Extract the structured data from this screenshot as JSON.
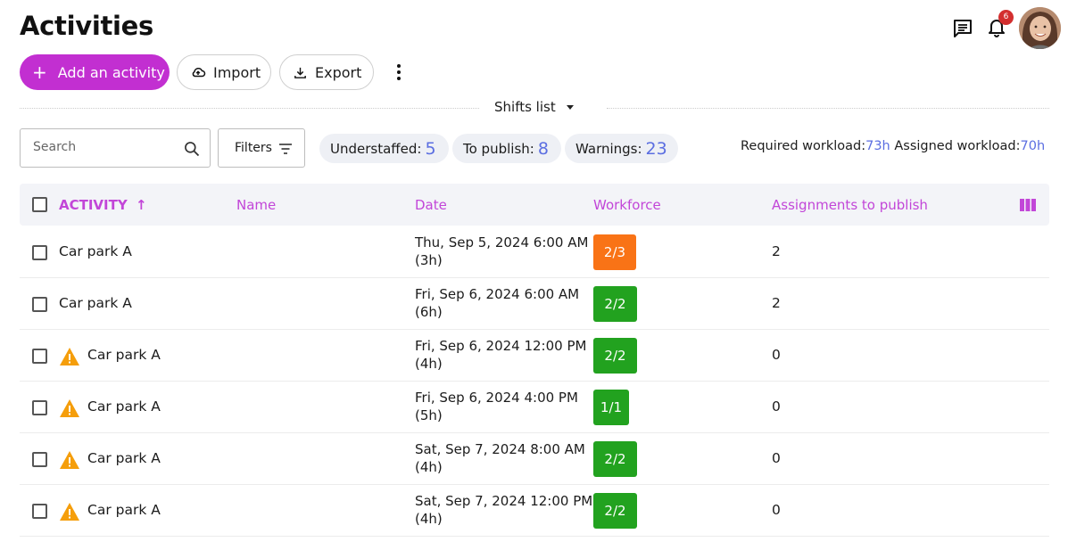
{
  "header": {
    "title": "Activities",
    "notification_count": "6"
  },
  "toolbar": {
    "add_label": "Add an activity",
    "import_label": "Import",
    "export_label": "Export"
  },
  "view": {
    "label": "Shifts list"
  },
  "search": {
    "placeholder": "Search"
  },
  "filters": {
    "label": "Filters"
  },
  "stats": [
    {
      "label": "Understaffed:",
      "value": "5"
    },
    {
      "label": "To publish:",
      "value": "8"
    },
    {
      "label": "Warnings:",
      "value": "23"
    }
  ],
  "workload": {
    "required_label": "Required workload:",
    "required_value": "73h",
    "assigned_label": "Assigned workload:",
    "assigned_value": "70h"
  },
  "table": {
    "columns": [
      "ACTIVITY",
      "Name",
      "Date",
      "Workforce",
      "Assignments to publish"
    ],
    "sort_indicator": "↑",
    "rows": [
      {
        "warning": false,
        "activity": "Car park A",
        "date_line1": "Thu, Sep 5, 2024 6:00 AM",
        "date_line2": "(3h)",
        "workforce": "2/3",
        "workforce_status": "understaffed",
        "assignments": "2"
      },
      {
        "warning": false,
        "activity": "Car park A",
        "date_line1": "Fri, Sep 6, 2024 6:00 AM",
        "date_line2": "(6h)",
        "workforce": "2/2",
        "workforce_status": "full",
        "assignments": "2"
      },
      {
        "warning": true,
        "activity": "Car park A",
        "date_line1": "Fri, Sep 6, 2024 12:00 PM",
        "date_line2": "(4h)",
        "workforce": "2/2",
        "workforce_status": "full",
        "assignments": "0"
      },
      {
        "warning": true,
        "activity": "Car park A",
        "date_line1": "Fri, Sep 6, 2024 4:00 PM",
        "date_line2": "(5h)",
        "workforce": "1/1",
        "workforce_status": "full",
        "assignments": "0"
      },
      {
        "warning": true,
        "activity": "Car park A",
        "date_line1": "Sat, Sep 7, 2024 8:00 AM",
        "date_line2": "(4h)",
        "workforce": "2/2",
        "workforce_status": "full",
        "assignments": "0"
      },
      {
        "warning": true,
        "activity": "Car park A",
        "date_line1": "Sat, Sep 7, 2024 12:00 PM",
        "date_line2": "(4h)",
        "workforce": "2/2",
        "workforce_status": "full",
        "assignments": "0"
      }
    ]
  },
  "colors": {
    "primary": "#c22fd1",
    "header_text": "#c246d8",
    "stat_value": "#5b6ee1",
    "understaffed": "#f97316",
    "full": "#22a21f",
    "warning": "#f59e0b"
  },
  "icons": {
    "chat": "chat-icon",
    "bell": "bell-icon",
    "import": "cloud-upload-icon",
    "export": "download-icon",
    "more": "more-vertical-icon",
    "search": "search-icon",
    "filters": "filter-icon",
    "columns": "columns-icon",
    "warning": "warning-icon"
  }
}
